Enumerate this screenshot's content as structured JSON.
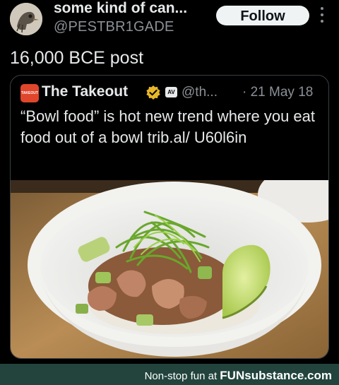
{
  "author": {
    "display_name": "some kind of can...",
    "handle": "@PESTBR1GADE",
    "follow_label": "Follow"
  },
  "post": {
    "text": "16,000 BCE post"
  },
  "quoted_post": {
    "avatar_text": "TAKEOUT",
    "name": "The Takeout",
    "badge_label": "AV",
    "handle": "@th...",
    "date": "· 21 May 18",
    "text": "“Bowl food” is hot new trend where you eat food out of a bowl trib.al/ U60l6in",
    "image": "bowl-of-poke-photo"
  },
  "watermark": {
    "prefix": "Non-stop fun at ",
    "brand": "FUNsubstance.com"
  },
  "colors": {
    "background": "#000000",
    "text": "#e7e9ea",
    "muted": "#8b9196",
    "follow_button": "#eff3f4",
    "verified_gold": "#e8b729",
    "watermark_bar": "#22443d"
  }
}
